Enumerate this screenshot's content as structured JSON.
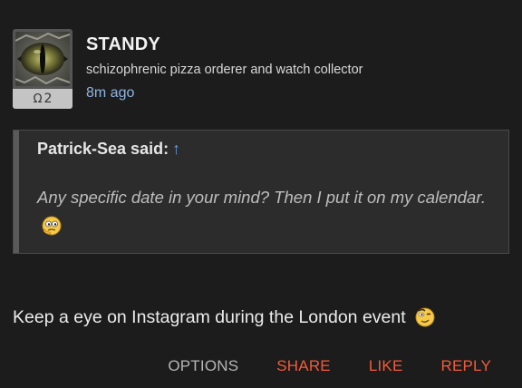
{
  "post": {
    "author": {
      "username": "STANDY",
      "title": "schizophrenic pizza orderer and watch collector",
      "rank_symbol": "Ω",
      "rank_value": "2",
      "avatar_icon": "reptile-eye-avatar"
    },
    "timestamp": "8m ago",
    "quote": {
      "author_label": "Patrick-Sea said:",
      "link_glyph": "↑",
      "text": "Any specific date in your mind? Then I put it on my calendar.",
      "emoji_icon": "thinking-emoji-icon"
    },
    "body": {
      "text": "Keep a eye on Instagram during the London event",
      "emoji_icon": "wink-emoji-icon"
    },
    "actions": {
      "options": "OPTIONS",
      "share": "SHARE",
      "like": "LIKE",
      "reply": "REPLY"
    }
  },
  "colors": {
    "background": "#1c1c1c",
    "accent": "#f45a3a",
    "link": "#5f9fe6",
    "timestamp": "#8fb4e2"
  }
}
